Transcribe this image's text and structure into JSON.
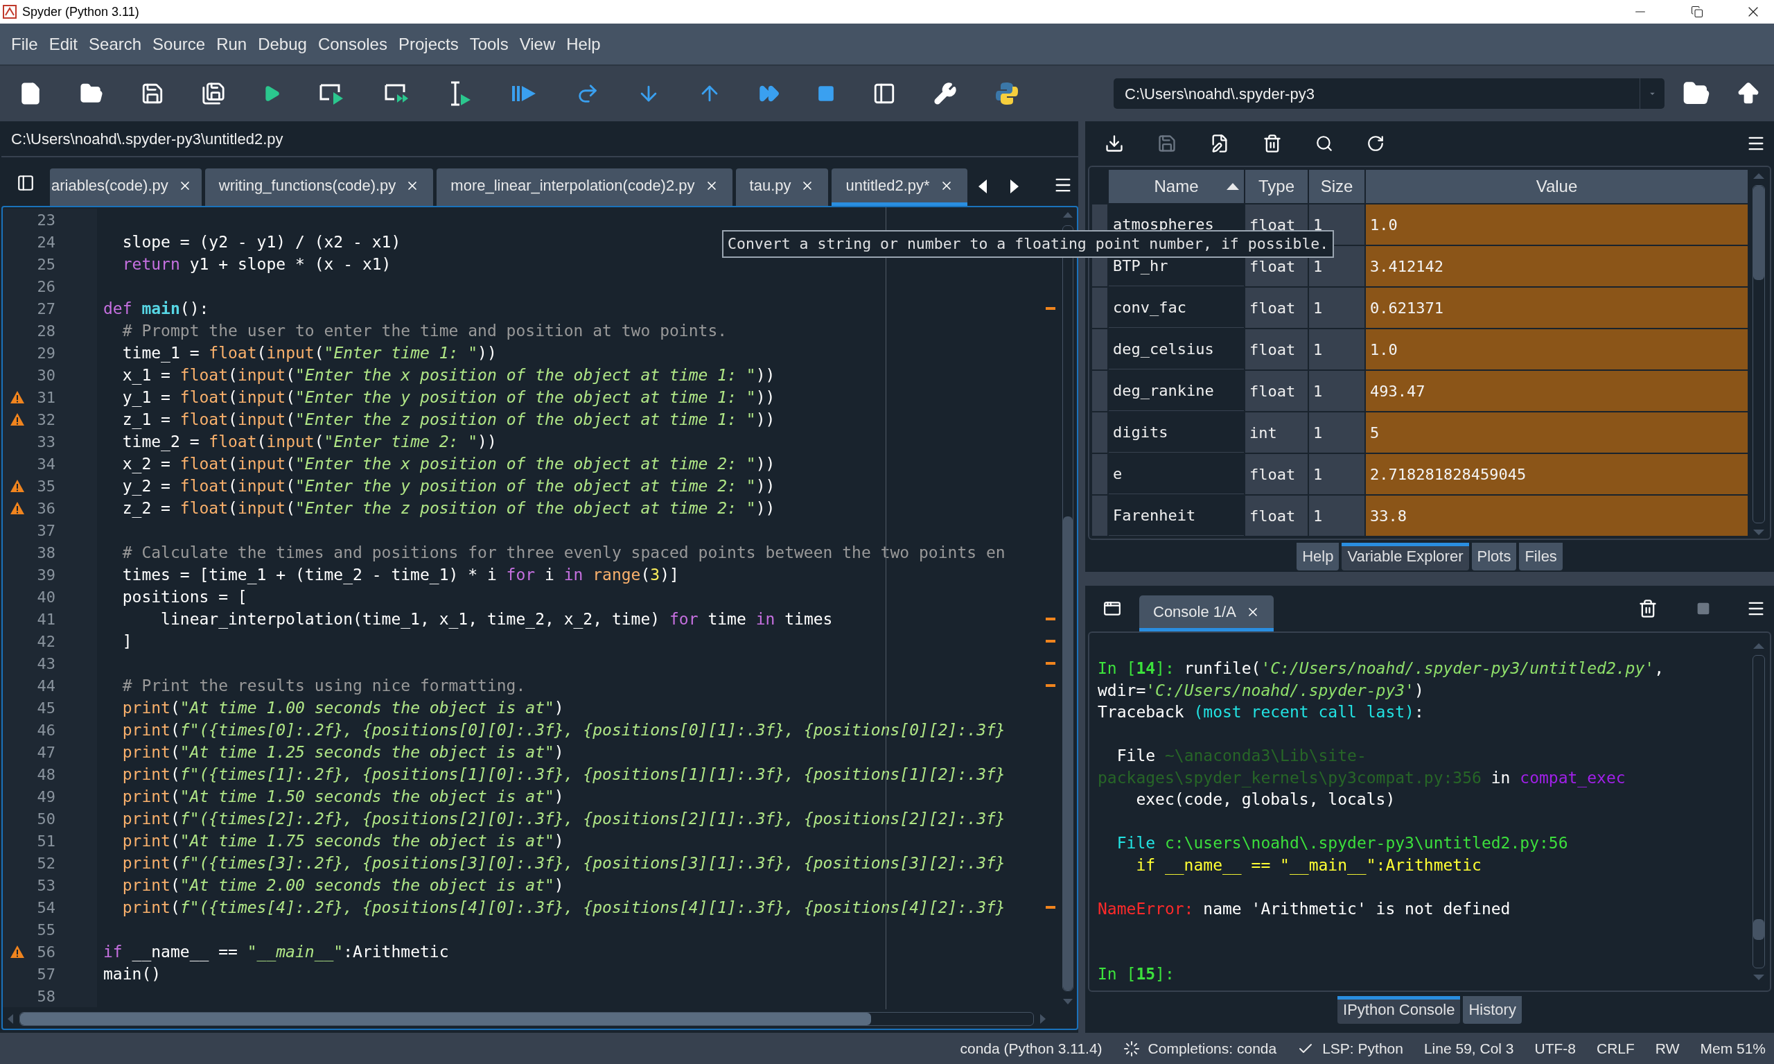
{
  "window": {
    "title": "Spyder (Python 3.11)"
  },
  "menu": [
    "File",
    "Edit",
    "Search",
    "Source",
    "Run",
    "Debug",
    "Consoles",
    "Projects",
    "Tools",
    "View",
    "Help"
  ],
  "working_directory": {
    "value": "C:\\Users\\noahd\\.spyder-py3"
  },
  "editor": {
    "file_path": "C:\\Users\\noahd\\.spyder-py3\\untitled2.py",
    "tabs": [
      {
        "label": "ariables(code).py",
        "selected": false
      },
      {
        "label": "writing_functions(code).py",
        "selected": false
      },
      {
        "label": "more_linear_interpolation(code)2.py",
        "selected": false
      },
      {
        "label": "tau.py",
        "selected": false
      },
      {
        "label": "untitled2.py*",
        "selected": true
      }
    ],
    "lines": [
      {
        "number": "23",
        "warning": false,
        "flag": false
      },
      {
        "number": "24",
        "warning": false,
        "flag": false,
        "indented": true,
        "tokens": [
          {
            "kind": "plain",
            "text": "slope = (y2 - y1) / (x2 - x1)"
          }
        ]
      },
      {
        "number": "25",
        "warning": false,
        "flag": false,
        "indented": true,
        "tokens": [
          {
            "kind": "keyword",
            "text": "return"
          },
          {
            "kind": "plain",
            "text": " y1 + slope * (x - x1)"
          }
        ]
      },
      {
        "number": "26",
        "warning": false,
        "flag": false
      },
      {
        "number": "27",
        "warning": false,
        "flag": true,
        "indented": false,
        "tokens": [
          {
            "kind": "keyword",
            "text": "def"
          },
          {
            "kind": "definition",
            "text": " main"
          },
          {
            "kind": "plain",
            "text": "():"
          }
        ]
      },
      {
        "number": "28",
        "warning": false,
        "flag": false,
        "indented": true,
        "tokens": [
          {
            "kind": "comment",
            "text": "# Prompt the user to enter the time and position at two points."
          }
        ]
      },
      {
        "number": "29",
        "warning": false,
        "flag": false,
        "indented": true,
        "tokens": [
          {
            "kind": "plain",
            "text": "time_1 = "
          },
          {
            "kind": "builtin",
            "text": "float"
          },
          {
            "kind": "plain",
            "text": "("
          },
          {
            "kind": "builtin",
            "text": "input"
          },
          {
            "kind": "plain",
            "text": "("
          },
          {
            "kind": "string",
            "text": "\"Enter time 1: \""
          },
          {
            "kind": "plain",
            "text": "))"
          }
        ]
      },
      {
        "number": "30",
        "warning": false,
        "flag": false,
        "indented": true,
        "tokens": [
          {
            "kind": "plain",
            "text": "x_1 = "
          },
          {
            "kind": "builtin",
            "text": "float"
          },
          {
            "kind": "plain",
            "text": "("
          },
          {
            "kind": "builtin",
            "text": "input"
          },
          {
            "kind": "plain",
            "text": "("
          },
          {
            "kind": "string",
            "text": "\"Enter the x position of the object at time 1: \""
          },
          {
            "kind": "plain",
            "text": "))"
          }
        ]
      },
      {
        "number": "31",
        "warning": true,
        "flag": false,
        "indented": true,
        "tokens": [
          {
            "kind": "plain",
            "text": "y_1 = "
          },
          {
            "kind": "builtin",
            "text": "float"
          },
          {
            "kind": "plain",
            "text": "("
          },
          {
            "kind": "builtin",
            "text": "input"
          },
          {
            "kind": "plain",
            "text": "("
          },
          {
            "kind": "string",
            "text": "\"Enter the y position of the object at time 1: \""
          },
          {
            "kind": "plain",
            "text": "))"
          }
        ]
      },
      {
        "number": "32",
        "warning": true,
        "flag": false,
        "indented": true,
        "tokens": [
          {
            "kind": "plain",
            "text": "z_1 = "
          },
          {
            "kind": "builtin",
            "text": "float"
          },
          {
            "kind": "plain",
            "text": "("
          },
          {
            "kind": "builtin",
            "text": "input"
          },
          {
            "kind": "plain",
            "text": "("
          },
          {
            "kind": "string",
            "text": "\"Enter the z position of the object at time 1: \""
          },
          {
            "kind": "plain",
            "text": "))"
          }
        ]
      },
      {
        "number": "33",
        "warning": false,
        "flag": false,
        "indented": true,
        "tokens": [
          {
            "kind": "plain",
            "text": "time_2 = "
          },
          {
            "kind": "builtin",
            "text": "float"
          },
          {
            "kind": "plain",
            "text": "("
          },
          {
            "kind": "builtin",
            "text": "input"
          },
          {
            "kind": "plain",
            "text": "("
          },
          {
            "kind": "string",
            "text": "\"Enter time 2: \""
          },
          {
            "kind": "plain",
            "text": "))"
          }
        ]
      },
      {
        "number": "34",
        "warning": false,
        "flag": false,
        "indented": true,
        "tokens": [
          {
            "kind": "plain",
            "text": "x_2 = "
          },
          {
            "kind": "builtin",
            "text": "float"
          },
          {
            "kind": "plain",
            "text": "("
          },
          {
            "kind": "builtin",
            "text": "input"
          },
          {
            "kind": "plain",
            "text": "("
          },
          {
            "kind": "string",
            "text": "\"Enter the x position of the object at time 2: \""
          },
          {
            "kind": "plain",
            "text": "))"
          }
        ]
      },
      {
        "number": "35",
        "warning": true,
        "flag": false,
        "indented": true,
        "tokens": [
          {
            "kind": "plain",
            "text": "y_2 = "
          },
          {
            "kind": "builtin",
            "text": "float"
          },
          {
            "kind": "plain",
            "text": "("
          },
          {
            "kind": "builtin",
            "text": "input"
          },
          {
            "kind": "plain",
            "text": "("
          },
          {
            "kind": "string",
            "text": "\"Enter the y position of the object at time 2: \""
          },
          {
            "kind": "plain",
            "text": "))"
          }
        ]
      },
      {
        "number": "36",
        "warning": true,
        "flag": false,
        "indented": true,
        "tokens": [
          {
            "kind": "plain",
            "text": "z_2 = "
          },
          {
            "kind": "builtin",
            "text": "float"
          },
          {
            "kind": "plain",
            "text": "("
          },
          {
            "kind": "builtin",
            "text": "input"
          },
          {
            "kind": "plain",
            "text": "("
          },
          {
            "kind": "string",
            "text": "\"Enter the z position of the object at time 2: \""
          },
          {
            "kind": "plain",
            "text": "))"
          }
        ]
      },
      {
        "number": "37",
        "warning": false,
        "flag": false
      },
      {
        "number": "38",
        "warning": false,
        "flag": false,
        "indented": true,
        "tokens": [
          {
            "kind": "comment",
            "text": "# Calculate the times and positions for three evenly spaced points between the two points en"
          }
        ]
      },
      {
        "number": "39",
        "warning": false,
        "flag": false,
        "indented": true,
        "tokens": [
          {
            "kind": "plain",
            "text": "times = [time_1 + (time_2 - time_1) * i "
          },
          {
            "kind": "keyword",
            "text": "for"
          },
          {
            "kind": "plain",
            "text": " i "
          },
          {
            "kind": "keyword",
            "text": "in "
          },
          {
            "kind": "builtin",
            "text": "range"
          },
          {
            "kind": "plain",
            "text": "("
          },
          {
            "kind": "number",
            "text": "3"
          },
          {
            "kind": "plain",
            "text": ")]"
          }
        ]
      },
      {
        "number": "40",
        "warning": false,
        "flag": false,
        "indented": true,
        "tokens": [
          {
            "kind": "plain",
            "text": "positions = ["
          }
        ]
      },
      {
        "number": "41",
        "warning": false,
        "flag": true,
        "indented": true,
        "tokens": [
          {
            "kind": "plain",
            "text": "    linear_interpolation(time_1, x_1, time_2, x_2, time) "
          },
          {
            "kind": "keyword",
            "text": "for"
          },
          {
            "kind": "plain",
            "text": " time "
          },
          {
            "kind": "keyword",
            "text": "in"
          },
          {
            "kind": "plain",
            "text": " times"
          }
        ]
      },
      {
        "number": "42",
        "warning": false,
        "flag": true,
        "indented": true,
        "tokens": [
          {
            "kind": "plain",
            "text": "]"
          }
        ]
      },
      {
        "number": "43",
        "warning": false,
        "flag": true
      },
      {
        "number": "44",
        "warning": false,
        "flag": true,
        "indented": true,
        "tokens": [
          {
            "kind": "comment",
            "text": "# Print the results using nice formatting."
          }
        ]
      },
      {
        "number": "45",
        "warning": false,
        "flag": false,
        "indented": true,
        "tokens": [
          {
            "kind": "builtin",
            "text": "print"
          },
          {
            "kind": "plain",
            "text": "("
          },
          {
            "kind": "string",
            "text": "\"At time 1.00 seconds the object is at\""
          },
          {
            "kind": "plain",
            "text": ")"
          }
        ]
      },
      {
        "number": "46",
        "warning": false,
        "flag": false,
        "indented": true,
        "tokens": [
          {
            "kind": "builtin",
            "text": "print"
          },
          {
            "kind": "plain",
            "text": "("
          },
          {
            "kind": "string",
            "text": "f\"({times[0]:.2f}, {positions[0][0]:.3f}, {positions[0][1]:.3f}, {positions[0][2]:.3f}"
          }
        ]
      },
      {
        "number": "47",
        "warning": false,
        "flag": false,
        "indented": true,
        "tokens": [
          {
            "kind": "builtin",
            "text": "print"
          },
          {
            "kind": "plain",
            "text": "("
          },
          {
            "kind": "string",
            "text": "\"At time 1.25 seconds the object is at\""
          },
          {
            "kind": "plain",
            "text": ")"
          }
        ]
      },
      {
        "number": "48",
        "warning": false,
        "flag": false,
        "indented": true,
        "tokens": [
          {
            "kind": "builtin",
            "text": "print"
          },
          {
            "kind": "plain",
            "text": "("
          },
          {
            "kind": "string",
            "text": "f\"({times[1]:.2f}, {positions[1][0]:.3f}, {positions[1][1]:.3f}, {positions[1][2]:.3f}"
          }
        ]
      },
      {
        "number": "49",
        "warning": false,
        "flag": false,
        "indented": true,
        "tokens": [
          {
            "kind": "builtin",
            "text": "print"
          },
          {
            "kind": "plain",
            "text": "("
          },
          {
            "kind": "string",
            "text": "\"At time 1.50 seconds the object is at\""
          },
          {
            "kind": "plain",
            "text": ")"
          }
        ]
      },
      {
        "number": "50",
        "warning": false,
        "flag": false,
        "indented": true,
        "tokens": [
          {
            "kind": "builtin",
            "text": "print"
          },
          {
            "kind": "plain",
            "text": "("
          },
          {
            "kind": "string",
            "text": "f\"({times[2]:.2f}, {positions[2][0]:.3f}, {positions[2][1]:.3f}, {positions[2][2]:.3f}"
          }
        ]
      },
      {
        "number": "51",
        "warning": false,
        "flag": false,
        "indented": true,
        "tokens": [
          {
            "kind": "builtin",
            "text": "print"
          },
          {
            "kind": "plain",
            "text": "("
          },
          {
            "kind": "string",
            "text": "\"At time 1.75 seconds the object is at\""
          },
          {
            "kind": "plain",
            "text": ")"
          }
        ]
      },
      {
        "number": "52",
        "warning": false,
        "flag": false,
        "indented": true,
        "tokens": [
          {
            "kind": "builtin",
            "text": "print"
          },
          {
            "kind": "plain",
            "text": "("
          },
          {
            "kind": "string",
            "text": "f\"({times[3]:.2f}, {positions[3][0]:.3f}, {positions[3][1]:.3f}, {positions[3][2]:.3f}"
          }
        ]
      },
      {
        "number": "53",
        "warning": false,
        "flag": false,
        "indented": true,
        "tokens": [
          {
            "kind": "builtin",
            "text": "print"
          },
          {
            "kind": "plain",
            "text": "("
          },
          {
            "kind": "string",
            "text": "\"At time 2.00 seconds the object is at\""
          },
          {
            "kind": "plain",
            "text": ")"
          }
        ]
      },
      {
        "number": "54",
        "warning": false,
        "flag": true,
        "indented": true,
        "tokens": [
          {
            "kind": "builtin",
            "text": "print"
          },
          {
            "kind": "plain",
            "text": "("
          },
          {
            "kind": "string",
            "text": "f\"({times[4]:.2f}, {positions[4][0]:.3f}, {positions[4][1]:.3f}, {positions[4][2]:.3f}"
          }
        ]
      },
      {
        "number": "55",
        "warning": false,
        "flag": false
      },
      {
        "number": "56",
        "warning": true,
        "flag": false,
        "indented": false,
        "tokens": [
          {
            "kind": "keyword",
            "text": "if"
          },
          {
            "kind": "plain",
            "text": " __name__ == "
          },
          {
            "kind": "string",
            "text": "\"__main__\""
          },
          {
            "kind": "plain",
            "text": ":Arithmetic"
          }
        ]
      },
      {
        "number": "57",
        "warning": false,
        "flag": false,
        "indented": false,
        "tokens": [
          {
            "kind": "plain",
            "text": "main()"
          }
        ]
      },
      {
        "number": "58",
        "warning": false,
        "flag": false
      }
    ]
  },
  "tooltip": "Convert a string or number to a floating point number, if possible.",
  "variable_explorer": {
    "columns": [
      "Name",
      "Type",
      "Size",
      "Value"
    ],
    "rows": [
      {
        "name": "atmospheres",
        "type": "float",
        "size": "1",
        "value": "1.0"
      },
      {
        "name": "BTP_hr",
        "type": "float",
        "size": "1",
        "value": "3.412142"
      },
      {
        "name": "conv_fac",
        "type": "float",
        "size": "1",
        "value": "0.621371"
      },
      {
        "name": "deg_celsius",
        "type": "float",
        "size": "1",
        "value": "1.0"
      },
      {
        "name": "deg_rankine",
        "type": "float",
        "size": "1",
        "value": "493.47"
      },
      {
        "name": "digits",
        "type": "int",
        "size": "1",
        "value": "5"
      },
      {
        "name": "e",
        "type": "float",
        "size": "1",
        "value": "2.718281828459045"
      },
      {
        "name": "Farenheit",
        "type": "float",
        "size": "1",
        "value": "33.8"
      }
    ]
  },
  "upper_tabs": [
    {
      "label": "Help",
      "selected": false
    },
    {
      "label": "Variable Explorer",
      "selected": true
    },
    {
      "label": "Plots",
      "selected": false
    },
    {
      "label": "Files",
      "selected": false
    }
  ],
  "console": {
    "tab": {
      "label": "Console 1/A",
      "selected": true
    },
    "lines": [
      {
        "kind": "text",
        "tokens": [
          {
            "kind": "prompt",
            "text": "In ["
          },
          {
            "kind": "prompt_number",
            "text": "14"
          },
          {
            "kind": "prompt",
            "text": "]: "
          },
          {
            "kind": "plain",
            "text": "runfile("
          },
          {
            "kind": "string",
            "text": "'C:/Users/noahd/.spyder-py3/untitled2.py'"
          },
          {
            "kind": "plain",
            "text": ","
          }
        ]
      },
      {
        "kind": "text",
        "tokens": [
          {
            "kind": "plain",
            "text": "wdir="
          },
          {
            "kind": "string",
            "text": "'C:/Users/noahd/.spyder-py3'"
          },
          {
            "kind": "plain",
            "text": ")"
          }
        ]
      },
      {
        "kind": "text",
        "tokens": [
          {
            "kind": "plain",
            "text": "Traceback "
          },
          {
            "kind": "cyan",
            "text": "(most recent call last)"
          },
          {
            "kind": "plain",
            "text": ":"
          }
        ]
      },
      {
        "kind": "blank"
      },
      {
        "kind": "text",
        "tokens": [
          {
            "kind": "plain",
            "text": "  File "
          },
          {
            "kind": "dim",
            "text": "~\\anaconda3\\Lib\\site-"
          }
        ]
      },
      {
        "kind": "text",
        "tokens": [
          {
            "kind": "dim",
            "text": "packages\\spyder_kernels\\py3compat.py:356"
          },
          {
            "kind": "plain",
            "text": " in "
          },
          {
            "kind": "purple",
            "text": "compat_exec"
          }
        ]
      },
      {
        "kind": "text",
        "tokens": [
          {
            "kind": "plain",
            "text": "    exec(code, globals, locals)"
          }
        ]
      },
      {
        "kind": "blank"
      },
      {
        "kind": "text",
        "tokens": [
          {
            "kind": "cyan",
            "text": "  File "
          },
          {
            "kind": "green",
            "text": "c:\\users\\noahd\\.spyder-py3\\untitled2.py:56"
          }
        ]
      },
      {
        "kind": "text",
        "tokens": [
          {
            "kind": "yellow",
            "text": "    if __name__ == \"__main__\":Arithmetic"
          }
        ]
      },
      {
        "kind": "blank"
      },
      {
        "kind": "text",
        "tokens": [
          {
            "kind": "red",
            "text": "NameError: "
          },
          {
            "kind": "plain",
            "text": "name 'Arithmetic' is not defined"
          }
        ]
      },
      {
        "kind": "blank"
      },
      {
        "kind": "blank"
      },
      {
        "kind": "text",
        "tokens": [
          {
            "kind": "prompt",
            "text": "In ["
          },
          {
            "kind": "prompt_number",
            "text": "15"
          },
          {
            "kind": "prompt",
            "text": "]:"
          }
        ]
      }
    ]
  },
  "lower_tabs": [
    {
      "label": "IPython Console",
      "selected": true
    },
    {
      "label": "History",
      "selected": false
    }
  ],
  "status_bar": [
    {
      "kind": "plain",
      "text": "conda (Python 3.11.4)"
    },
    {
      "kind": "progress",
      "text": "Completions: conda"
    },
    {
      "kind": "ok",
      "text": "LSP: Python"
    },
    {
      "kind": "plain",
      "text": "Line 59, Col 3"
    },
    {
      "kind": "plain",
      "text": "UTF-8"
    },
    {
      "kind": "plain",
      "text": "CRLF"
    },
    {
      "kind": "plain",
      "text": "RW"
    },
    {
      "kind": "plain",
      "text": "Mem 51%"
    }
  ]
}
